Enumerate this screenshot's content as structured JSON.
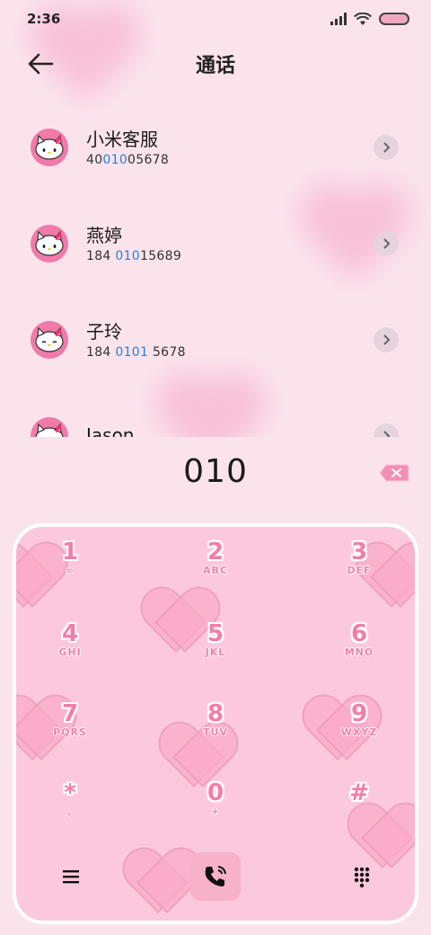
{
  "status_bar": {
    "time": "2:36"
  },
  "header": {
    "title": "通话"
  },
  "contacts": [
    {
      "name": "小米客服",
      "number_pre": "40",
      "number_hl": "010",
      "number_post": "05678"
    },
    {
      "name": "燕婷",
      "number_pre": "184 ",
      "number_hl": "010",
      "number_post": "15689"
    },
    {
      "name": "子玲",
      "number_pre": "184 ",
      "number_hl": "0101",
      "number_post": " 5678"
    },
    {
      "name": "Jason",
      "number_pre": "",
      "number_hl": "",
      "number_post": ""
    }
  ],
  "dial_input": {
    "value": "010"
  },
  "keypad": {
    "keys": [
      {
        "digit": "1",
        "letters": "∞"
      },
      {
        "digit": "2",
        "letters": "ABC"
      },
      {
        "digit": "3",
        "letters": "DEF"
      },
      {
        "digit": "4",
        "letters": "GHI"
      },
      {
        "digit": "5",
        "letters": "JKL"
      },
      {
        "digit": "6",
        "letters": "MNO"
      },
      {
        "digit": "7",
        "letters": "PQRS"
      },
      {
        "digit": "8",
        "letters": "TUV"
      },
      {
        "digit": "9",
        "letters": "WXYZ"
      },
      {
        "digit": "*",
        "letters": ","
      },
      {
        "digit": "0",
        "letters": "+"
      },
      {
        "digit": "#",
        "letters": ""
      }
    ]
  },
  "colors": {
    "background": "#fbe3ec",
    "keypad_bg": "#fcc9dc",
    "key_digit": "#f27ea7",
    "highlight": "#2b7fd9"
  },
  "icons": {
    "back": "arrow-left-icon",
    "backspace": "backspace-icon",
    "call": "phone-icon",
    "menu": "menu-icon",
    "dialpad": "dialpad-icon"
  }
}
